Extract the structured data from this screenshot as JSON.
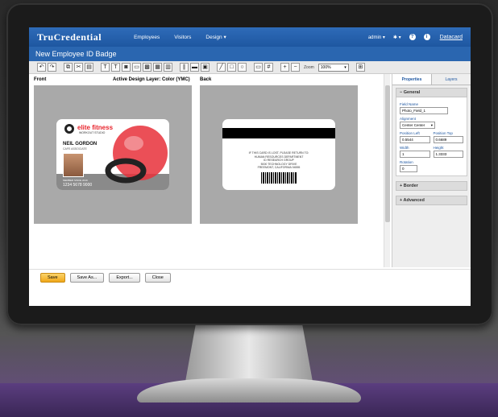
{
  "app": {
    "brand": "TruCredential",
    "nav": [
      "Employees",
      "Visitors",
      "Design ▾"
    ],
    "user": "admin ▾",
    "vendor": "Datacard"
  },
  "page": {
    "title": "New Employee ID Badge"
  },
  "toolbar": {
    "zoom_label": "Zoom",
    "zoom_value": "100%"
  },
  "design": {
    "front_label": "Front",
    "layer_label": "Active Design Layer: Color (YMC)",
    "back_label": "Back"
  },
  "front_card": {
    "brand_name": "elite fitness",
    "brand_sub": "WORKOUT STUDIO",
    "person_name": "NEIL GORDON",
    "person_title": "CAFE ASSOCIATE",
    "person_sub": "MEMBER SINCE 2019",
    "id_number": "1234 5678 9000",
    "colors": {
      "accent": "#e8242c",
      "ball": "#e8303a"
    }
  },
  "back_card": {
    "lines": [
      "IF THIS CARD IS LOST, PLEASE RETURN TO:",
      "HUMAN RESOURCES DEPARTMENT",
      "ID RESEARCH GROUP",
      "5000 TECHNOLOGY DRIVE",
      "FREEMONT, CALIFORNIA 94555"
    ]
  },
  "properties": {
    "tabs": [
      "Properties",
      "Layers"
    ],
    "general_header": "General",
    "field_name_label": "Field Name",
    "field_name_value": "Photo_Field_1",
    "alignment_label": "Alignment",
    "alignment_value": "Center Center",
    "pos_left_label": "Position Left",
    "pos_left_value": "0.5544",
    "pos_top_label": "Position Top",
    "pos_top_value": "0.6689",
    "width_label": "Width",
    "width_value": "1",
    "height_label": "Height",
    "height_value": "1.3333",
    "rotation_label": "Rotation",
    "rotation_value": "0",
    "border_header": "Border",
    "advanced_header": "Advanced"
  },
  "actions": {
    "save": "Save",
    "save_as": "Save As...",
    "export": "Export...",
    "close": "Close"
  }
}
